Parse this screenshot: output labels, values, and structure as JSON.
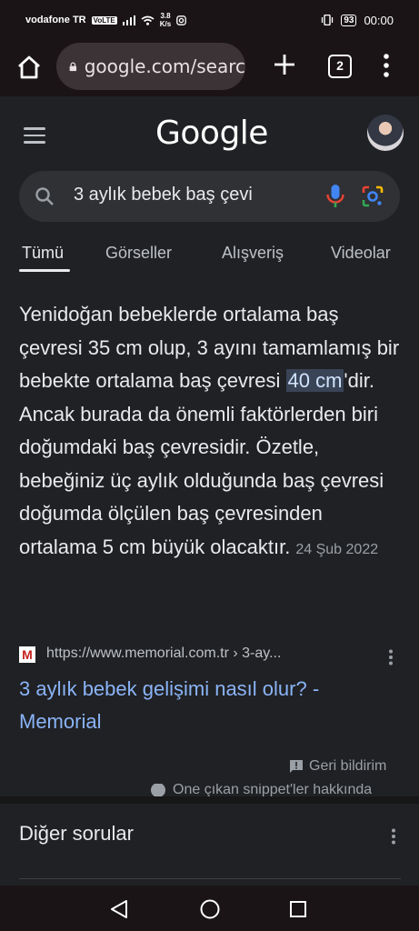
{
  "status_bar": {
    "carrier": "vodafone TR",
    "volte": "VoLTE",
    "net_speed_value": "3.8",
    "net_speed_unit": "K/s",
    "battery": "93",
    "time": "00:00"
  },
  "browser": {
    "url": "google.com/searc",
    "tab_count": "2"
  },
  "google": {
    "logo": "Google",
    "query": "3 aylık bebek baş çevi"
  },
  "tabs": [
    "Tümü",
    "Görseller",
    "Alışveriş",
    "Videolar"
  ],
  "snippet": {
    "text_before": "Yenidoğan bebeklerde ortalama baş çevresi 35 cm olup, 3 ayını tamamlamış bir bebekte ortalama baş çevresi ",
    "highlight": "40 cm",
    "text_after": "'dir. Ancak burada da önemli faktörlerden biri doğumdaki baş çevresidir. Özetle, bebeğiniz üç aylık olduğunda baş çevresi doğumda ölçülen baş çevresinden ortalama 5 cm büyük olacaktır.",
    "date": "24 Şub 2022"
  },
  "source": {
    "favicon_letter": "M",
    "url": "https://www.memorial.com.tr › 3-ay...",
    "title": "3 aylık bebek gelişimi nasıl olur? - Memorial"
  },
  "feedback_label": "Geri bildirim",
  "about_label": "Öne çıkan snippet'ler hakkında",
  "other_questions_label": "Diğer sorular",
  "colors": {
    "background": "#202124",
    "link": "#8ab4f8",
    "highlight_bg": "#394457"
  }
}
